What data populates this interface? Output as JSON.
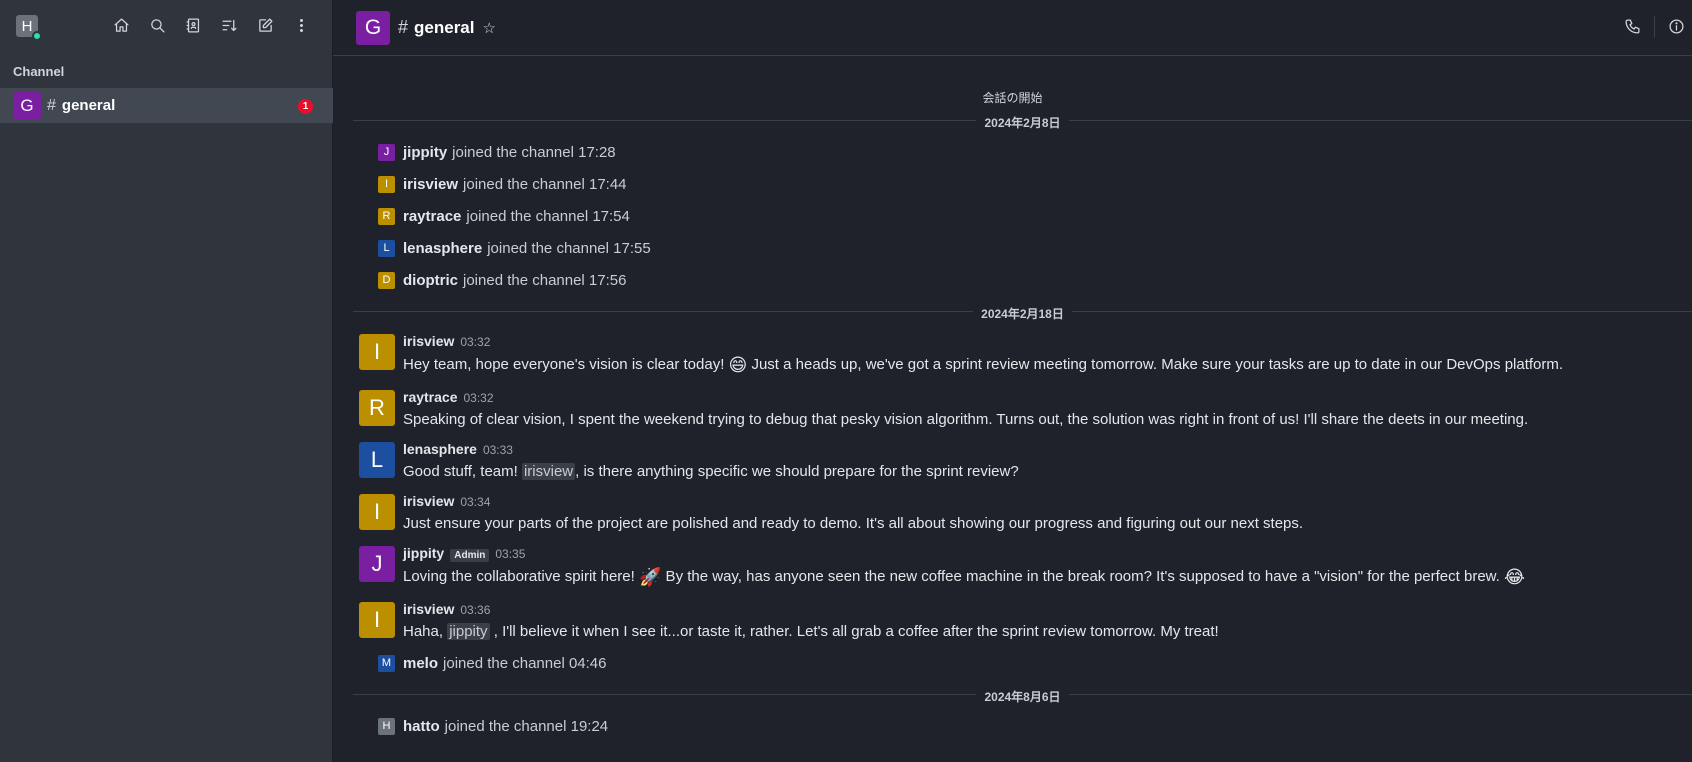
{
  "sidebar": {
    "user_initial": "H",
    "section_label": "Channel",
    "channel": {
      "initial": "G",
      "hash": "#",
      "name": "general",
      "unread": "1"
    }
  },
  "header": {
    "initial": "G",
    "hash": "#",
    "title": "general",
    "star": "☆"
  },
  "conversation_start": "会話の開始",
  "dates": [
    "2024年2月8日",
    "2024年2月18日",
    "2024年8月6日"
  ],
  "system_messages": [
    {
      "initial": "J",
      "user": "jippity",
      "text": "joined the channel 17:28"
    },
    {
      "initial": "I",
      "user": "irisview",
      "text": "joined the channel 17:44"
    },
    {
      "initial": "R",
      "user": "raytrace",
      "text": "joined the channel 17:54"
    },
    {
      "initial": "L",
      "user": "lenasphere",
      "text": "joined the channel 17:55"
    },
    {
      "initial": "D",
      "user": "dioptric",
      "text": "joined the channel 17:56"
    },
    {
      "initial": "M",
      "user": "melo",
      "text": "joined the channel 04:46"
    },
    {
      "initial": "H",
      "user": "hatto",
      "text": "joined the channel 19:24"
    }
  ],
  "messages": [
    {
      "initial": "I",
      "user": "irisview",
      "time": "03:32",
      "text_a": "Hey team, hope everyone's vision is clear today! ",
      "emoji": "😄",
      "text_b": " Just a heads up, we've got a sprint review meeting tomorrow. Make sure your tasks are up to date in our DevOps platform."
    },
    {
      "initial": "R",
      "user": "raytrace",
      "time": "03:32",
      "text": "Speaking of clear vision, I spent the weekend trying to debug that pesky vision algorithm. Turns out, the solution was right in front of us! I'll share the deets in our meeting."
    },
    {
      "initial": "L",
      "user": "lenasphere",
      "time": "03:33",
      "text_a": "Good stuff, team! ",
      "mention": "irisview",
      "text_b": ", is there anything specific we should prepare for the sprint review?"
    },
    {
      "initial": "I",
      "user": "irisview",
      "time": "03:34",
      "text": "Just ensure your parts of the project are polished and ready to demo. It's all about showing our progress and figuring out our next steps."
    },
    {
      "initial": "J",
      "user": "jippity",
      "role": "Admin",
      "time": "03:35",
      "text_a": "Loving the collaborative spirit here! ",
      "emoji_a": "🚀",
      "text_b": " By the way, has anyone seen the new coffee machine in the break room? It's supposed to have a \"vision\" for the perfect brew. ",
      "emoji_b": "😂"
    },
    {
      "initial": "I",
      "user": "irisview",
      "time": "03:36",
      "text_a": "Haha, ",
      "mention": "jippity",
      "text_b": " , I'll believe it when I see it...or taste it, rather. Let's all grab a coffee after the sprint review tomorrow. My treat!"
    }
  ],
  "colors": {
    "purple": "#7a1fa2",
    "gold": "#bb8f00",
    "blue": "#1d4fa0",
    "gray": "#6c727a",
    "badge": "#ec0d2a"
  }
}
